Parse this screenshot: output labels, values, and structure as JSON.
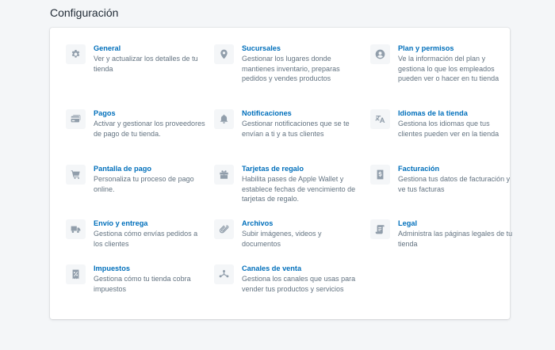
{
  "page": {
    "title": "Configuración"
  },
  "settings": {
    "general": {
      "title": "General",
      "description": "Ver y actualizar los detalles de tu tienda"
    },
    "sucursales": {
      "title": "Sucursales",
      "description": "Gestionar los lugares donde mantienes inventario, preparas pedidos y vendes productos"
    },
    "plan": {
      "title": "Plan y permisos",
      "description": "Ve la información del plan y gestiona lo que los empleados pueden ver o hacer en tu tienda"
    },
    "pagos": {
      "title": "Pagos",
      "description": "Activar y gestionar los proveedores de pago de tu tienda."
    },
    "notificaciones": {
      "title": "Notificaciones",
      "description": "Gestionar notificaciones que se te envían a ti y a tus clientes"
    },
    "idiomas": {
      "title": "Idiomas de la tienda",
      "description": "Gestiona los idiomas que tus clientes pueden ver en la tienda"
    },
    "pantalla_pago": {
      "title": "Pantalla de pago",
      "description": "Personaliza tu proceso de pago online."
    },
    "tarjetas_regalo": {
      "title": "Tarjetas de regalo",
      "description": "Habilita pases de Apple Wallet y establece fechas de vencimiento de tarjetas de regalo."
    },
    "facturacion": {
      "title": "Facturación",
      "description": "Gestiona tus datos de facturación y ve tus facturas"
    },
    "envio": {
      "title": "Envío y entrega",
      "description": "Gestiona cómo envías pedidos a los clientes"
    },
    "archivos": {
      "title": "Archivos",
      "description": "Subir imágenes, videos y documentos"
    },
    "legal": {
      "title": "Legal",
      "description": "Administra las páginas legales de tu tienda"
    },
    "impuestos": {
      "title": "Impuestos",
      "description": "Gestiona cómo tu tienda cobra impuestos"
    },
    "canales": {
      "title": "Canales de venta",
      "description": "Gestiona los canales que usas para vender tus productos y servicios"
    }
  },
  "icons": {
    "general": "gear-icon",
    "sucursales": "location-pin-icon",
    "plan": "user-circle-icon",
    "pagos": "credit-card-icon",
    "notificaciones": "bell-icon",
    "idiomas": "translate-icon",
    "pantalla_pago": "cart-icon",
    "tarjetas_regalo": "gift-icon",
    "facturacion": "dollar-receipt-icon",
    "envio": "truck-icon",
    "archivos": "paperclip-icon",
    "legal": "scroll-icon",
    "impuestos": "tax-receipt-icon",
    "canales": "channels-icon"
  },
  "colors": {
    "link": "#006fbb",
    "text_muted": "#637381",
    "icon": "#919eab",
    "background": "#f4f6f8"
  }
}
